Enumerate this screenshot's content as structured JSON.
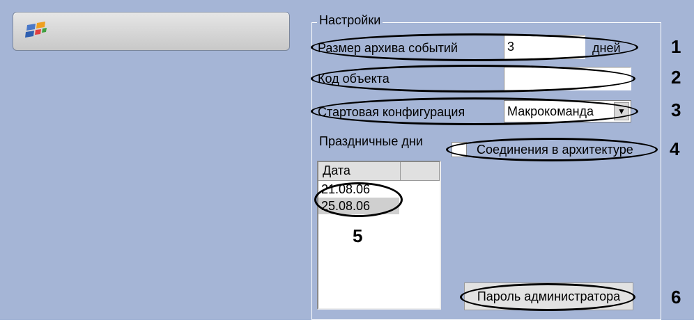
{
  "settings": {
    "group_title": "Настройки",
    "archive_size_label": "Размер архива событий",
    "archive_size_value": "3",
    "archive_size_unit": "дней",
    "object_code_label": "Код объекта",
    "object_code_value": "",
    "start_config_label": "Стартовая конфигурация",
    "start_config_value": "Макрокоманда",
    "holidays_label": "Праздничные дни",
    "connections_label": "Соединения в архитектуре",
    "holidays_table": {
      "column": "Дата",
      "rows": [
        "21.08.06",
        "25.08.06"
      ]
    },
    "admin_password_button": "Пароль администратора"
  },
  "callouts": [
    "1",
    "2",
    "3",
    "4",
    "5",
    "6"
  ],
  "icons": {
    "app_logo": "windows-logo-icon",
    "dropdown": "chevron-down-icon"
  }
}
